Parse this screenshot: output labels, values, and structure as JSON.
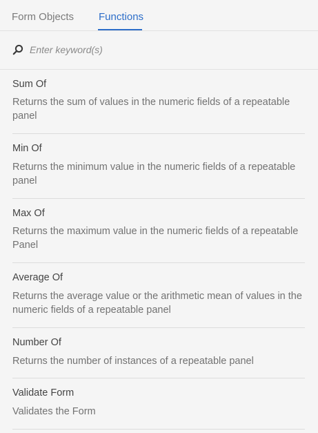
{
  "tabs": {
    "form_objects": "Form Objects",
    "functions": "Functions",
    "active": "functions"
  },
  "search": {
    "placeholder": "Enter keyword(s)",
    "value": ""
  },
  "functions": [
    {
      "title": "Sum Of",
      "description": "Returns the sum of values in the numeric fields of a repeatable panel"
    },
    {
      "title": "Min Of",
      "description": "Returns the minimum value in the numeric fields of a repeatable panel"
    },
    {
      "title": "Max Of",
      "description": "Returns the maximum value in the numeric fields of a repeatable Panel"
    },
    {
      "title": "Average Of",
      "description": "Returns the average value or the arithmetic mean of values in the numeric fields of a repeatable panel"
    },
    {
      "title": "Number Of",
      "description": "Returns the number of instances of a repeatable panel"
    },
    {
      "title": "Validate Form",
      "description": "Validates the Form"
    }
  ],
  "colors": {
    "accent": "#2d6ec9",
    "background": "#f5f5f5",
    "divider": "#dcdcdc"
  }
}
